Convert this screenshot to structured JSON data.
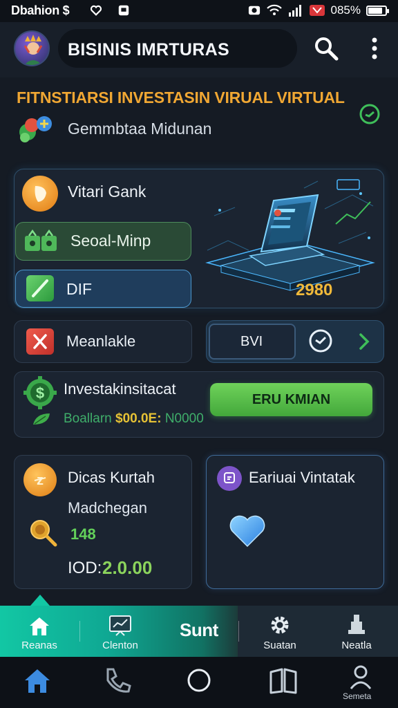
{
  "status_bar": {
    "left_text": "Dbahion $",
    "battery_text": "085%",
    "battery_level": 0.85,
    "icons": [
      "heart-icon",
      "box-icon",
      "camera-icon",
      "wifi-icon",
      "signal-icon",
      "app-badge-icon"
    ]
  },
  "app_bar": {
    "title": "BISINIS IMRTURAS",
    "icons": [
      "avatar",
      "search-icon",
      "more-vertical-icon"
    ]
  },
  "headline": {
    "title": "FITNSTIARSI  INVESTASIN VIRUAL VIRTUAL",
    "subtitle": "Gemmbtaa Midunan"
  },
  "card_main": {
    "title": "Vitari Gank",
    "nearby_label": "Seoal-Minp",
    "dif_label": "DIF",
    "value": "2980"
  },
  "row_message": {
    "label": "Meanlakle",
    "button_label": "BVI"
  },
  "invest": {
    "title": "Investakinsitacat",
    "amount_prefix": "Boallarn ",
    "amount_highlight": "$00.0E:",
    "amount_suffix": " N0000",
    "button_label": "ERU KMIAN"
  },
  "discount": {
    "title": "Dicas Kurtah",
    "subtitle": "Madchegan",
    "count": "148",
    "total_label": "IOD:",
    "total_value": "2.0.00"
  },
  "favorite": {
    "title": "Eariuai Vintatak"
  },
  "tabs": [
    {
      "label": "Reanas",
      "icon": "home-icon"
    },
    {
      "label": "Clenton",
      "icon": "chart-board-icon"
    },
    {
      "label": "Sunt",
      "icon": "none"
    },
    {
      "label": "Suatan",
      "icon": "gear-icon"
    },
    {
      "label": "Neatla",
      "icon": "trophy-icon"
    }
  ],
  "system_nav": {
    "profile_label": "Semeta"
  },
  "colors": {
    "accent_green": "#63d15a",
    "accent_orange": "#f0a733",
    "accent_teal": "#12c7a4",
    "card_bg": "#1b2431",
    "page_bg": "#151b24"
  }
}
